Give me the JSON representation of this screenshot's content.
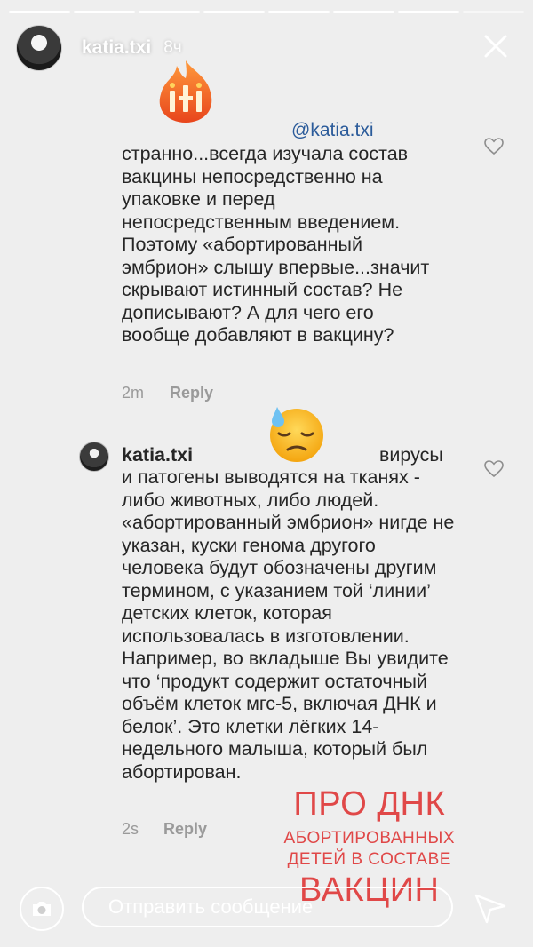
{
  "story": {
    "username": "katia.txi",
    "time": "8ч",
    "progress_segments": 8
  },
  "comments": [
    {
      "mention": "@katia.txi",
      "text": "странно...всегда изучала состав вакцины непосредственно на упаковке и перед непосредственным введением. Поэтому «абортированный эмбрион» слышу впервые...значит скрывают истинный состав? Не дописывают? А для чего его вообще добавляют в вакцину?",
      "age": "2m",
      "reply_label": "Reply"
    },
    {
      "username": "katia.txi",
      "text_tail": "вирусы",
      "text": "и патогены выводятся на тканях - либо животных, либо людей. «абортированный эмбрион» нигде не указан, куски генома другого человека будут обозначены другим термином, с указанием той ‘линии’ детских клеток, которая использовалась в изготовлении. Например, во вкладыше Вы увидите что ‘продукт содержит остаточный объём клеток мгс-5, включая ДНК и белок’. Это клетки лёгких 14-недельного малыша, который был абортирован.",
      "age": "2s",
      "reply_label": "Reply"
    }
  ],
  "overlay": {
    "line1": "ПРО ДНК",
    "line2": "АБОРТИРОВАННЫХ",
    "line3": "ДЕТЕЙ В СОСТАВЕ",
    "line4": "ВАКЦИН",
    "color": "#e04848"
  },
  "bottom": {
    "message_placeholder": "Отправить сообщение"
  }
}
